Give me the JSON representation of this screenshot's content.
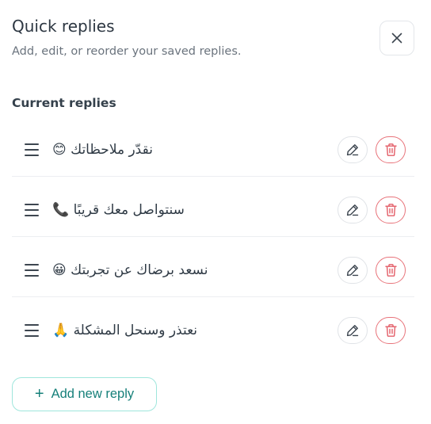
{
  "header": {
    "title": "Quick replies",
    "subtitle": "Add, edit, or reorder your saved replies.",
    "close_icon": "close-icon"
  },
  "section": {
    "title": "Current replies"
  },
  "replies": [
    {
      "text": "نقدّر ملاحظاتك 😊"
    },
    {
      "text": "سنتواصل معك قريبًا 📞"
    },
    {
      "text": "نسعد برضاك عن تجربتك 😀"
    },
    {
      "text": "نعتذر وسنحل المشكلة 🙏"
    }
  ],
  "actions": {
    "add_label": "Add new reply",
    "edit_icon": "pencil-icon",
    "delete_icon": "trash-icon",
    "drag_icon": "drag-handle-icon"
  },
  "colors": {
    "accent": "#16807a",
    "accent_border": "#9fe6dc",
    "danger": "#e35d67",
    "text": "#2f3a45",
    "muted": "#6a737d"
  }
}
